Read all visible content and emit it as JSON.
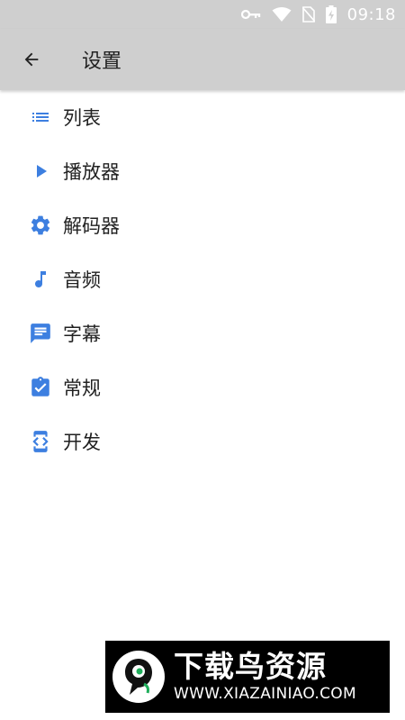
{
  "status_bar": {
    "time": "09:18",
    "icons": [
      "key-icon",
      "wifi-icon",
      "no-sim-icon",
      "battery-charging-icon"
    ]
  },
  "app_bar": {
    "back_icon": "arrow-back-icon",
    "title": "设置"
  },
  "menu": {
    "items": [
      {
        "label": "列表",
        "icon": "list-icon"
      },
      {
        "label": "播放器",
        "icon": "play-icon"
      },
      {
        "label": "解码器",
        "icon": "gear-icon"
      },
      {
        "label": "音频",
        "icon": "music-note-icon"
      },
      {
        "label": "字幕",
        "icon": "subtitles-icon"
      },
      {
        "label": "常规",
        "icon": "assignment-check-icon"
      },
      {
        "label": "开发",
        "icon": "developer-mode-icon"
      }
    ]
  },
  "watermark": {
    "title": "下载鸟资源",
    "url": "WWW.XIAZAINIAO.COM"
  },
  "colors": {
    "bar_background": "#cfcfcf",
    "icon_accent": "#3d7fe0",
    "text_primary": "#212121"
  }
}
